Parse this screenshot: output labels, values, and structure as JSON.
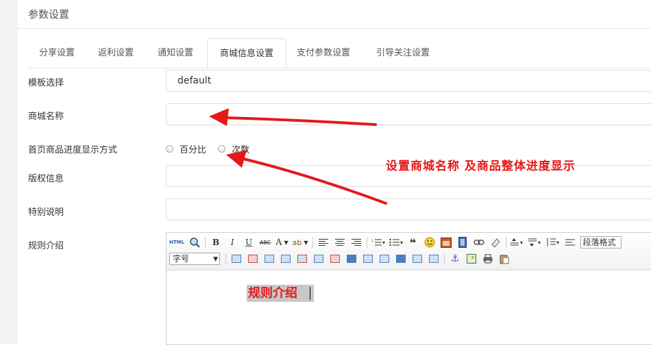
{
  "page": {
    "title": "参数设置"
  },
  "tabs": [
    {
      "label": "分享设置"
    },
    {
      "label": "返利设置"
    },
    {
      "label": "通知设置"
    },
    {
      "label": "商城信息设置",
      "active": true
    },
    {
      "label": "支付参数设置"
    },
    {
      "label": "引导关注设置"
    }
  ],
  "form": {
    "template": {
      "label": "模板选择",
      "value": "default"
    },
    "shop_name": {
      "label": "商城名称",
      "value": ""
    },
    "progress_mode": {
      "label": "首页商品进度显示方式",
      "options": [
        "百分比",
        "次数"
      ],
      "selected": null
    },
    "copyright": {
      "label": "版权信息",
      "value": ""
    },
    "special_note": {
      "label": "特别说明",
      "value": ""
    },
    "rules": {
      "label": "规则介绍",
      "content": "规则介绍"
    }
  },
  "editor": {
    "toolbar_row1": [
      "HTML",
      "preview-icon",
      "B",
      "I",
      "U",
      "ABC",
      "A",
      "ab",
      "align-left-icon",
      "align-center-icon",
      "align-right-icon",
      "ordered-list-icon",
      "unordered-list-icon",
      "quote-icon",
      "emoji-icon",
      "image-icon",
      "video-icon",
      "link-icon",
      "clear-format-icon",
      "indent-icon",
      "spacing-icon",
      "line-height-icon",
      "paragraph-icon"
    ],
    "font_size_label": "字号",
    "paragraph_label": "段落格式"
  },
  "annotation": {
    "text": "设置商城名称 及商品整体进度显示",
    "color": "#e3191a"
  },
  "colors": {
    "annotation_red": "#e3191a",
    "border": "#dddddd",
    "gutter": "#f3f3f3"
  }
}
